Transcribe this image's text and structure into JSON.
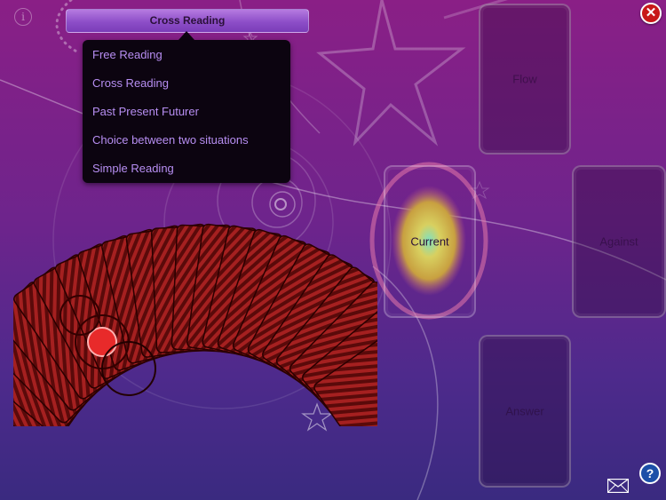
{
  "header": {
    "spread_selector_label": "Cross Reading"
  },
  "spread_menu": {
    "items": [
      "Free Reading",
      "Cross Reading",
      "Past Present Futurer",
      "Choice between two situations",
      "Simple Reading"
    ]
  },
  "slots": {
    "flow": "Flow",
    "current": "Current",
    "against": "Against",
    "answer": "Answer"
  },
  "icons": {
    "info": "info-icon",
    "close": "close-icon",
    "help": "help-icon",
    "mail": "mail-icon"
  },
  "colors": {
    "menu_text": "#b78ef2",
    "close_button": "#c81818",
    "help_button": "#1c4fa8",
    "card_back": "#8a1a1a"
  }
}
